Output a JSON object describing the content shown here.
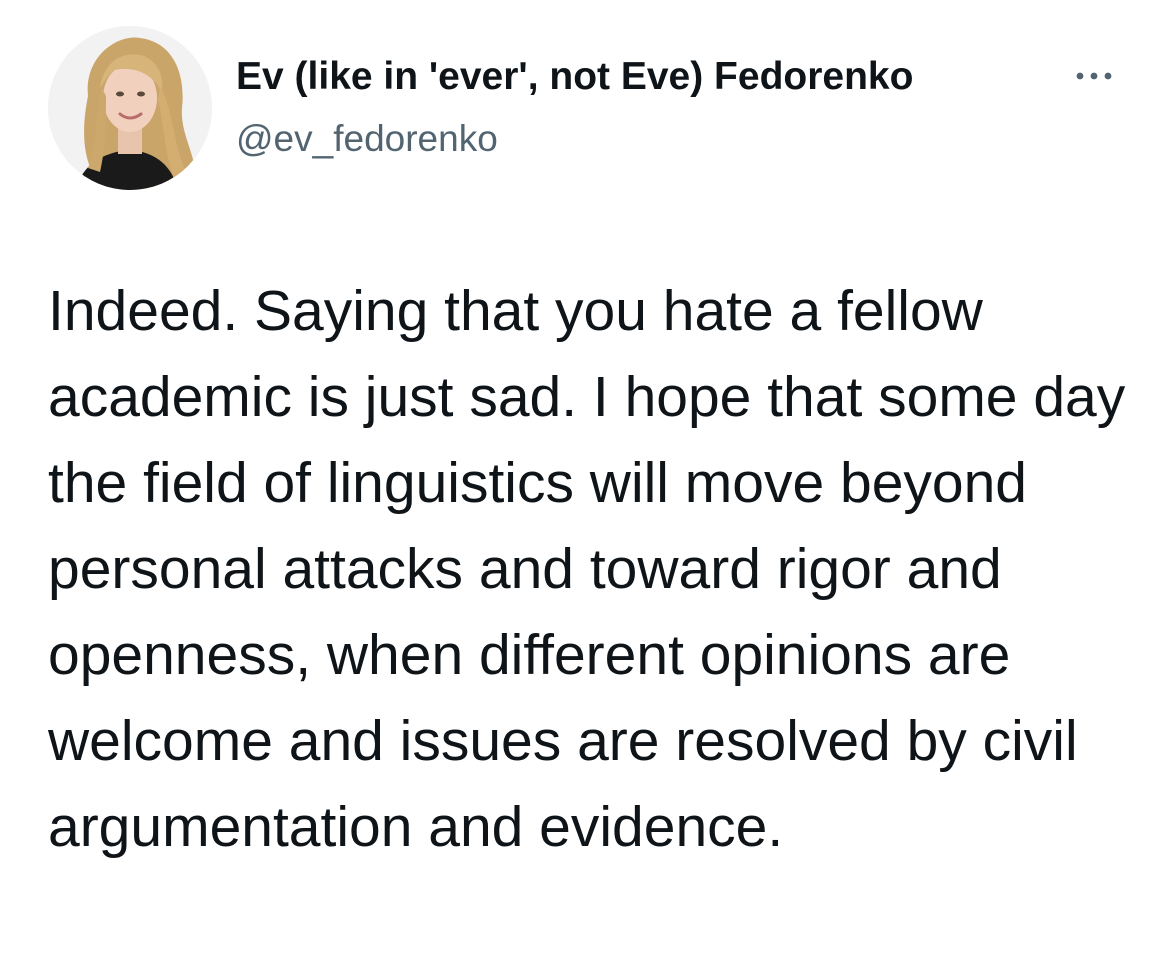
{
  "tweet": {
    "author": {
      "display_name": "Ev (like in 'ever', not Eve) Fedorenko",
      "handle": "@ev_fedorenko",
      "avatar_icon": "profile-photo"
    },
    "more_icon": "ellipsis-icon",
    "text": "Indeed. Saying that you hate a fellow academic is just sad. I hope that some day the field of linguistics will move beyond personal attacks and toward rigor and openness, when different opinions are welcome and issues are resolved by civil argumentation and evidence."
  },
  "colors": {
    "text_primary": "#0f1419",
    "text_secondary": "#536471",
    "background": "#ffffff"
  }
}
